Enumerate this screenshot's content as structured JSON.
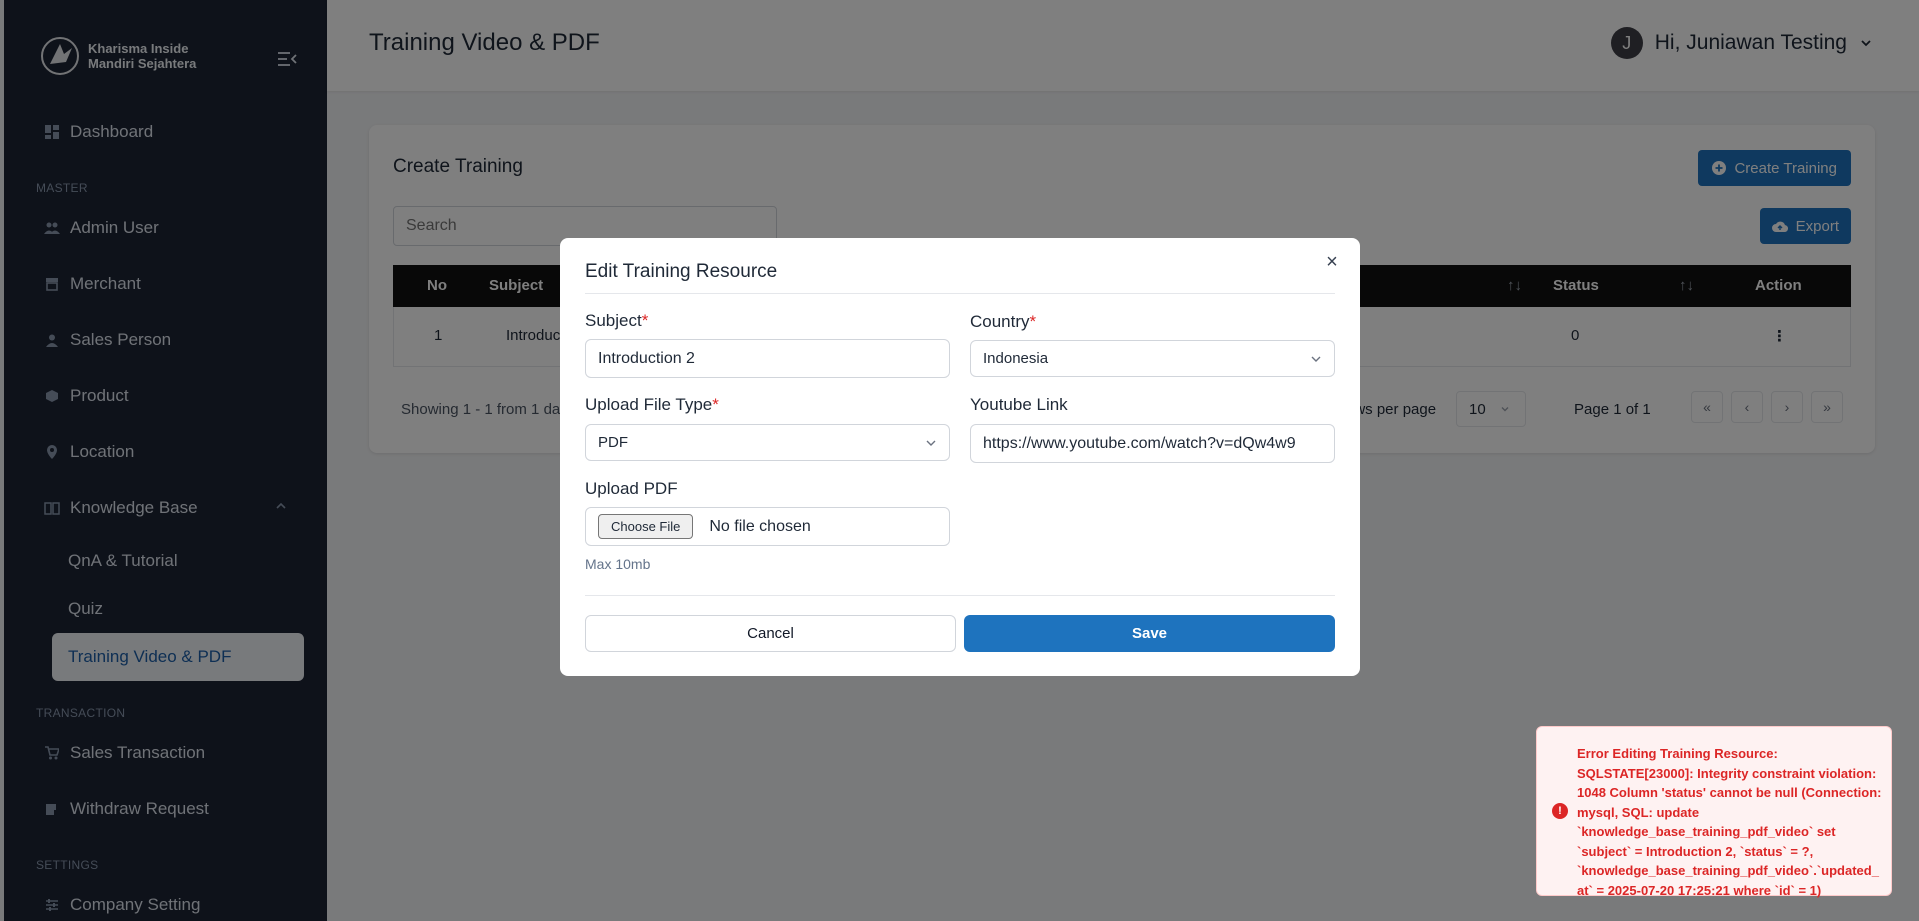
{
  "brand": {
    "line1": "Kharisma Inside",
    "line2": "Mandiri Sejahtera"
  },
  "sidebar": {
    "items": [
      {
        "label": "Dashboard"
      },
      {
        "label": "Admin User"
      },
      {
        "label": "Merchant"
      },
      {
        "label": "Sales Person"
      },
      {
        "label": "Product"
      },
      {
        "label": "Location"
      },
      {
        "label": "Knowledge Base"
      },
      {
        "label": "QnA & Tutorial"
      },
      {
        "label": "Quiz"
      },
      {
        "label": "Training Video & PDF"
      },
      {
        "label": "Sales Transaction"
      },
      {
        "label": "Withdraw Request"
      },
      {
        "label": "Company Setting"
      }
    ],
    "sections": {
      "master": "MASTER",
      "transaction": "TRANSACTION",
      "settings": "SETTINGS"
    }
  },
  "header": {
    "title": "Training Video & PDF",
    "avatar_initial": "J",
    "greeting": "Hi, Juniawan Testing"
  },
  "card": {
    "title": "Create Training",
    "create_label": "Create Training",
    "export_label": "Export",
    "search_placeholder": "Search",
    "columns": {
      "no": "No",
      "subject": "Subject",
      "status": "Status",
      "action": "Action"
    },
    "row": {
      "no": "1",
      "subject": "Introduc",
      "status": "0"
    },
    "showing": "Showing 1 - 1 from 1 data",
    "rows_per_page_label": "ows per page",
    "rows_per_page_value": "10",
    "page_info": "Page 1 of 1"
  },
  "modal": {
    "title": "Edit Training Resource",
    "subject_label": "Subject",
    "subject_value": "Introduction 2",
    "country_label": "Country",
    "country_value": "Indonesia",
    "file_type_label": "Upload File Type",
    "file_type_value": "PDF",
    "youtube_label": "Youtube Link",
    "youtube_value": "https://www.youtube.com/watch?v=dQw4w9",
    "upload_label": "Upload PDF",
    "choose_file": "Choose File",
    "no_file": "No file chosen",
    "max_hint": "Max 10mb",
    "cancel_label": "Cancel",
    "save_label": "Save"
  },
  "toast": {
    "message": "Error Editing Training Resource: SQLSTATE[23000]: Integrity constraint violation: 1048 Column 'status' cannot be null (Connection: mysql, SQL: update `knowledge_base_training_pdf_video` set `subject` = Introduction 2, `status` = ?, `knowledge_base_training_pdf_video`.`updated_at` = 2025-07-20 17:25:21 where `id` = 1)"
  },
  "colors": {
    "sidebar": "#1c2434",
    "accent": "#1e73be",
    "error": "#dc2626"
  }
}
